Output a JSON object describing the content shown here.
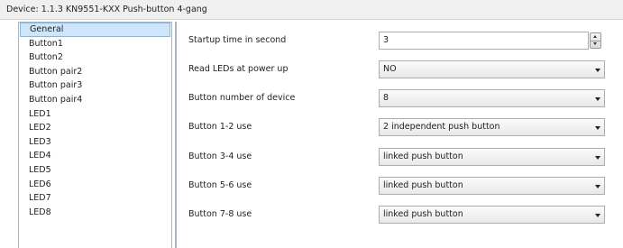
{
  "window": {
    "title": "Device: 1.1.3  KN9551-KXX Push-button 4-gang"
  },
  "sidebar": {
    "items": [
      {
        "label": "General"
      },
      {
        "label": "Button1"
      },
      {
        "label": "Button2"
      },
      {
        "label": "Button pair2"
      },
      {
        "label": "Button pair3"
      },
      {
        "label": "Button pair4"
      },
      {
        "label": "LED1"
      },
      {
        "label": "LED2"
      },
      {
        "label": "LED3"
      },
      {
        "label": "LED4"
      },
      {
        "label": "LED5"
      },
      {
        "label": "LED6"
      },
      {
        "label": "LED7"
      },
      {
        "label": "LED8"
      }
    ],
    "selected": "General"
  },
  "params": {
    "startup": {
      "label": "Startup time in second",
      "value": "3"
    },
    "read_leds": {
      "label": "Read LEDs at power up",
      "value": "NO"
    },
    "button_number": {
      "label": "Button number of device",
      "value": "8"
    },
    "b12": {
      "label": "Button 1-2 use",
      "value": "2 independent push button"
    },
    "b34": {
      "label": "Button 3-4 use",
      "value": "linked push button"
    },
    "b56": {
      "label": "Button 5-6 use",
      "value": "linked push button"
    },
    "b78": {
      "label": "Button 7-8 use",
      "value": "linked push button"
    }
  },
  "icons": {
    "dropdown": "chevron-down-icon",
    "spin_up": "spin-up-icon",
    "spin_down": "spin-down-icon"
  },
  "colors": {
    "selected_bg": "#cde6fb",
    "selected_border": "#84b6e3",
    "panel_border": "#a9b3bd"
  }
}
